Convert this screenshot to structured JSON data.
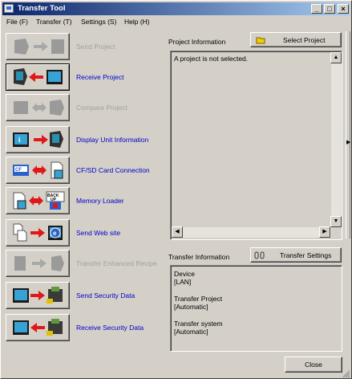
{
  "window": {
    "title": "Transfer Tool",
    "buttons": {
      "minimize": "_",
      "maximize": "□",
      "close": "×"
    }
  },
  "menu": [
    {
      "label": "File (F)"
    },
    {
      "label": "Transfer (T)"
    },
    {
      "label": "Settings (S)"
    },
    {
      "label": "Help (H)"
    }
  ],
  "actions": [
    {
      "label": "Send Project",
      "enabled": false,
      "icon": "send-project-icon"
    },
    {
      "label": "Receive Project",
      "enabled": true,
      "icon": "receive-project-icon"
    },
    {
      "label": "Compare Project",
      "enabled": false,
      "icon": "compare-project-icon"
    },
    {
      "label": "Display Unit Information",
      "enabled": true,
      "icon": "display-unit-info-icon"
    },
    {
      "label": "CF/SD Card Connection",
      "enabled": true,
      "icon": "cf-sd-card-icon"
    },
    {
      "label": "Memory Loader",
      "enabled": true,
      "icon": "memory-loader-icon"
    },
    {
      "label": "Send Web site",
      "enabled": true,
      "icon": "send-web-site-icon"
    },
    {
      "label": "Transfer Enhanced Recipe",
      "enabled": false,
      "icon": "transfer-enhanced-recipe-icon"
    },
    {
      "label": "Send Security Data",
      "enabled": true,
      "icon": "send-security-data-icon"
    },
    {
      "label": "Receive Security Data",
      "enabled": true,
      "icon": "receive-security-data-icon"
    }
  ],
  "project_info": {
    "label": "Project Information",
    "select_button": "Select Project",
    "text": "A project is not selected."
  },
  "transfer_info": {
    "label": "Transfer Information",
    "settings_button": "Transfer Settings",
    "device_label": "Device",
    "device_value": "[LAN]",
    "project_label": "Transfer Project",
    "project_value": "[Automatic]",
    "system_label": "Transfer system",
    "system_value": "[Automatic]"
  },
  "close_button": "Close",
  "colors": {
    "link": "#0000cc",
    "disabled": "#a0a0a0",
    "title_start": "#0a246a",
    "title_end": "#a6caf0"
  }
}
